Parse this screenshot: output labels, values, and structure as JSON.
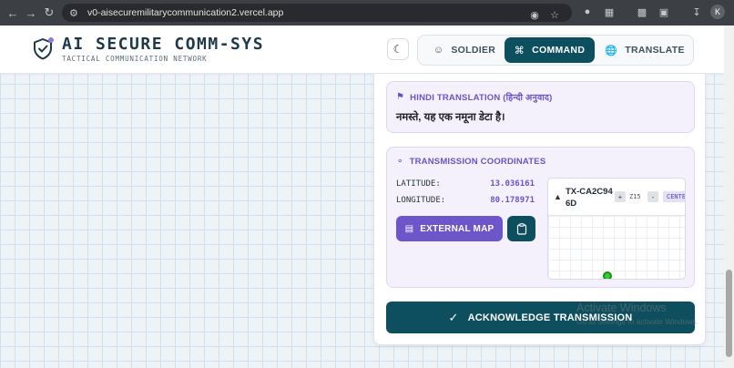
{
  "browser": {
    "url": "v0-aisecuremilitarycommunication2.vercel.app",
    "profile_initial": "K"
  },
  "header": {
    "title": "AI SECURE COMM-SYS",
    "subtitle": "TACTICAL COMMUNICATION NETWORK",
    "modes": [
      {
        "label": "SOLDIER",
        "icon": "user-icon",
        "active": false
      },
      {
        "label": "COMMAND",
        "icon": "command-icon",
        "active": true
      },
      {
        "label": "TRANSLATE",
        "icon": "globe-icon",
        "active": false
      }
    ]
  },
  "hindi_translation": {
    "title": "HINDI TRANSLATION (हिन्दी अनुवाद)",
    "text": "नमस्ते, यह एक नमूना डेटा है।"
  },
  "coordinates": {
    "title": "TRANSMISSION COORDINATES",
    "latitude_label": "LATITUDE:",
    "latitude_value": "13.036161",
    "longitude_label": "LONGITUDE:",
    "longitude_value": "80.178971",
    "external_map_label": "EXTERNAL MAP"
  },
  "map": {
    "tx_id": "TX-CA2C946D",
    "zoom_in": "+",
    "zoom_label": "Z15",
    "zoom_out": "-",
    "center_label": "CENTER"
  },
  "acknowledge_label": "ACKNOWLEDGE TRANSMISSION",
  "watermark": {
    "line1": "Activate Windows",
    "line2": "Go to Settings to activate Windows."
  },
  "colors": {
    "primary_teal": "#0e4f5f",
    "accent_purple": "#6d56c9",
    "marker_green": "#33cc33"
  }
}
